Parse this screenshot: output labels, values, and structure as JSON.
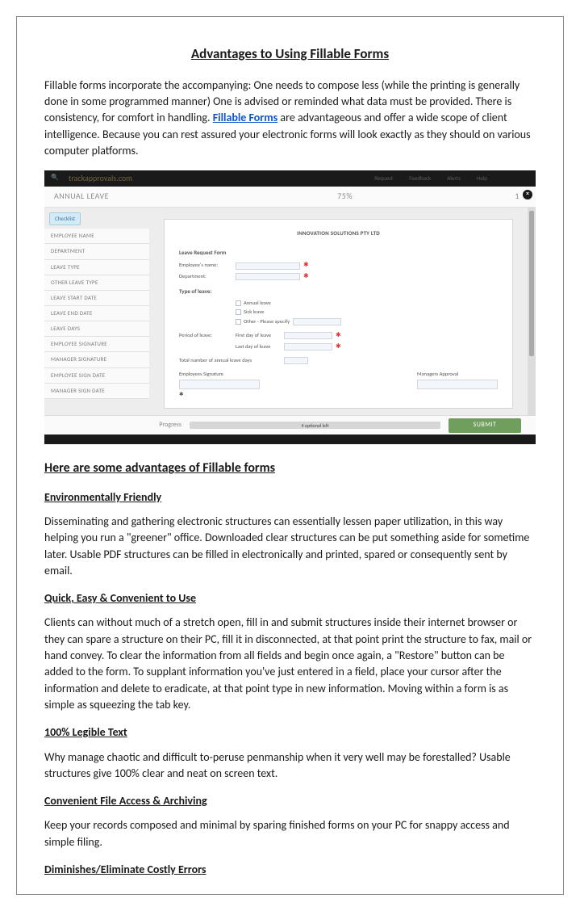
{
  "doc": {
    "title": "Advantages to Using Fillable Forms",
    "intro_before": "Fillable forms incorporate the accompanying: One needs to compose less (while the printing is generally done in some programmed manner) One is advised or reminded what data must be provided. There is consistency, for comfort in handling. ",
    "intro_link": "Fillable Forms",
    "intro_after": " are advantageous and offer a wide scope of client intelligence. Because you can rest assured your electronic forms will look exactly as they should on various computer platforms.",
    "h2": "Here are some advantages of Fillable forms",
    "sections": [
      {
        "heading": "Environmentally Friendly",
        "body": "Disseminating and gathering electronic structures can essentially lessen paper utilization, in this way helping you run a \"greener\" office. Downloaded clear structures can be put something aside for sometime later. Usable PDF structures can be filled in electronically and printed, spared or consequently sent by email."
      },
      {
        "heading": " Quick, Easy & Convenient to Use",
        "body": "Clients can without much of a stretch open, fill in and submit structures inside their internet browser or they can spare a structure on their PC, fill it in disconnected, at that point print the structure to fax, mail or hand convey. To clear the information from all fields and begin once again, a \"Restore\" button can be added to the form. To supplant information you've just entered in a field, place your cursor after the information and delete to eradicate, at that point type in new information. Moving within a form is as simple as squeezing the tab key."
      },
      {
        "heading": "100% Legible Text",
        "body": "Why manage chaotic and difficult to-peruse penmanship when it very well may be forestalled? Usable structures give 100% clear and neat on screen text."
      },
      {
        "heading": "Convenient File Access & Archiving",
        "body": "Keep your records composed and minimal by sparing finished forms on your PC for snappy access and simple filing."
      },
      {
        "heading": "Diminishes/Eliminate Costly Errors",
        "body": ""
      }
    ]
  },
  "screenshot": {
    "logo": "trackapprovals.com",
    "topnav": [
      "Request",
      "Feedback",
      "Alerts",
      "Help"
    ],
    "header": {
      "title": "ANNUAL LEAVE",
      "progress": "75%",
      "page": "1"
    },
    "checklist_tab": "Checklist",
    "sidebar": [
      "EMPLOYEE NAME",
      "DEPARTMENT",
      "LEAVE TYPE",
      "OTHER LEAVE TYPE",
      "LEAVE START DATE",
      "LEAVE END DATE",
      "LEAVE DAYS",
      "EMPLOYEE SIGNATURE",
      "MANAGER SIGNATURE",
      "EMPLOYEE SIGN DATE",
      "MANAGER SIGN DATE"
    ],
    "paper": {
      "company": "INNOVATION SOLUTIONS PTY LTD",
      "form_title": "Leave Request Form",
      "employee_name_label": "Employee's name:",
      "department_label": "Department:",
      "type_heading": "Type of leave:",
      "type_annual": "Annual leave",
      "type_sick": "Sick leave",
      "type_other": "Other - Please specify",
      "period_label": "Period of leave:",
      "first_day": "First day of leave",
      "last_day": "Last day of leave",
      "total_days": "Total number of annual leave days",
      "emp_sig": "Employees Signature",
      "mgr_sig": "Managers Approval"
    },
    "progress_label": "Progress",
    "progress_text": "4 optional left",
    "submit": "SUBMIT"
  }
}
